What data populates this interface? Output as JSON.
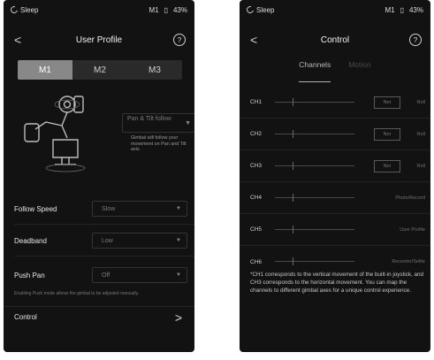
{
  "left": {
    "status": {
      "app": "Sleep",
      "mode": "M1",
      "battery": "43%"
    },
    "nav": {
      "title": "User Profile",
      "back": "<",
      "help": "?"
    },
    "segments": [
      {
        "label": "M1",
        "active": true
      },
      {
        "label": "M2",
        "active": false
      },
      {
        "label": "M3",
        "active": false
      }
    ],
    "mode": {
      "value": "Pan & Tilt follow",
      "note": "Gimbal will follow your movement on Pan and Tilt axis."
    },
    "settings": [
      {
        "label": "Follow Speed",
        "value": "Slow"
      },
      {
        "label": "Deadband",
        "value": "Low"
      },
      {
        "label": "Push Pan",
        "value": "Off"
      }
    ],
    "push_pan_note": "Enabling Push mode allows the gimbal to be adjusted manually.",
    "control_row": {
      "label": "Control",
      "chevron": ">"
    }
  },
  "right": {
    "status": {
      "app": "Sleep",
      "mode": "M1",
      "battery": "43%"
    },
    "nav": {
      "title": "Control",
      "back": "<",
      "help": "?"
    },
    "tabs": [
      {
        "label": "Channels",
        "active": true
      },
      {
        "label": "Motion",
        "active": false
      }
    ],
    "channels": [
      {
        "ch": "CH1",
        "nor": "Nor",
        "func": "Roll"
      },
      {
        "ch": "CH2",
        "nor": "Nor",
        "func": "Roll"
      },
      {
        "ch": "CH3",
        "nor": "Nor",
        "func": "Roll"
      },
      {
        "ch": "CH4",
        "nor": "",
        "func": "Photo/Record"
      },
      {
        "ch": "CH5",
        "nor": "",
        "func": "User Profile"
      },
      {
        "ch": "CH6",
        "nor": "",
        "func": "Recenter/Selfie"
      }
    ],
    "footnote": "*CH1 corresponds to the vertical movement of the built-in joystick, and CH3 corresponds to the horizontal movement. You can map the channels to different gimbal axes for a unique control experience."
  },
  "colors": {
    "screen_bg": "#121212",
    "segment_active": "#888888",
    "divider": "#242424"
  }
}
